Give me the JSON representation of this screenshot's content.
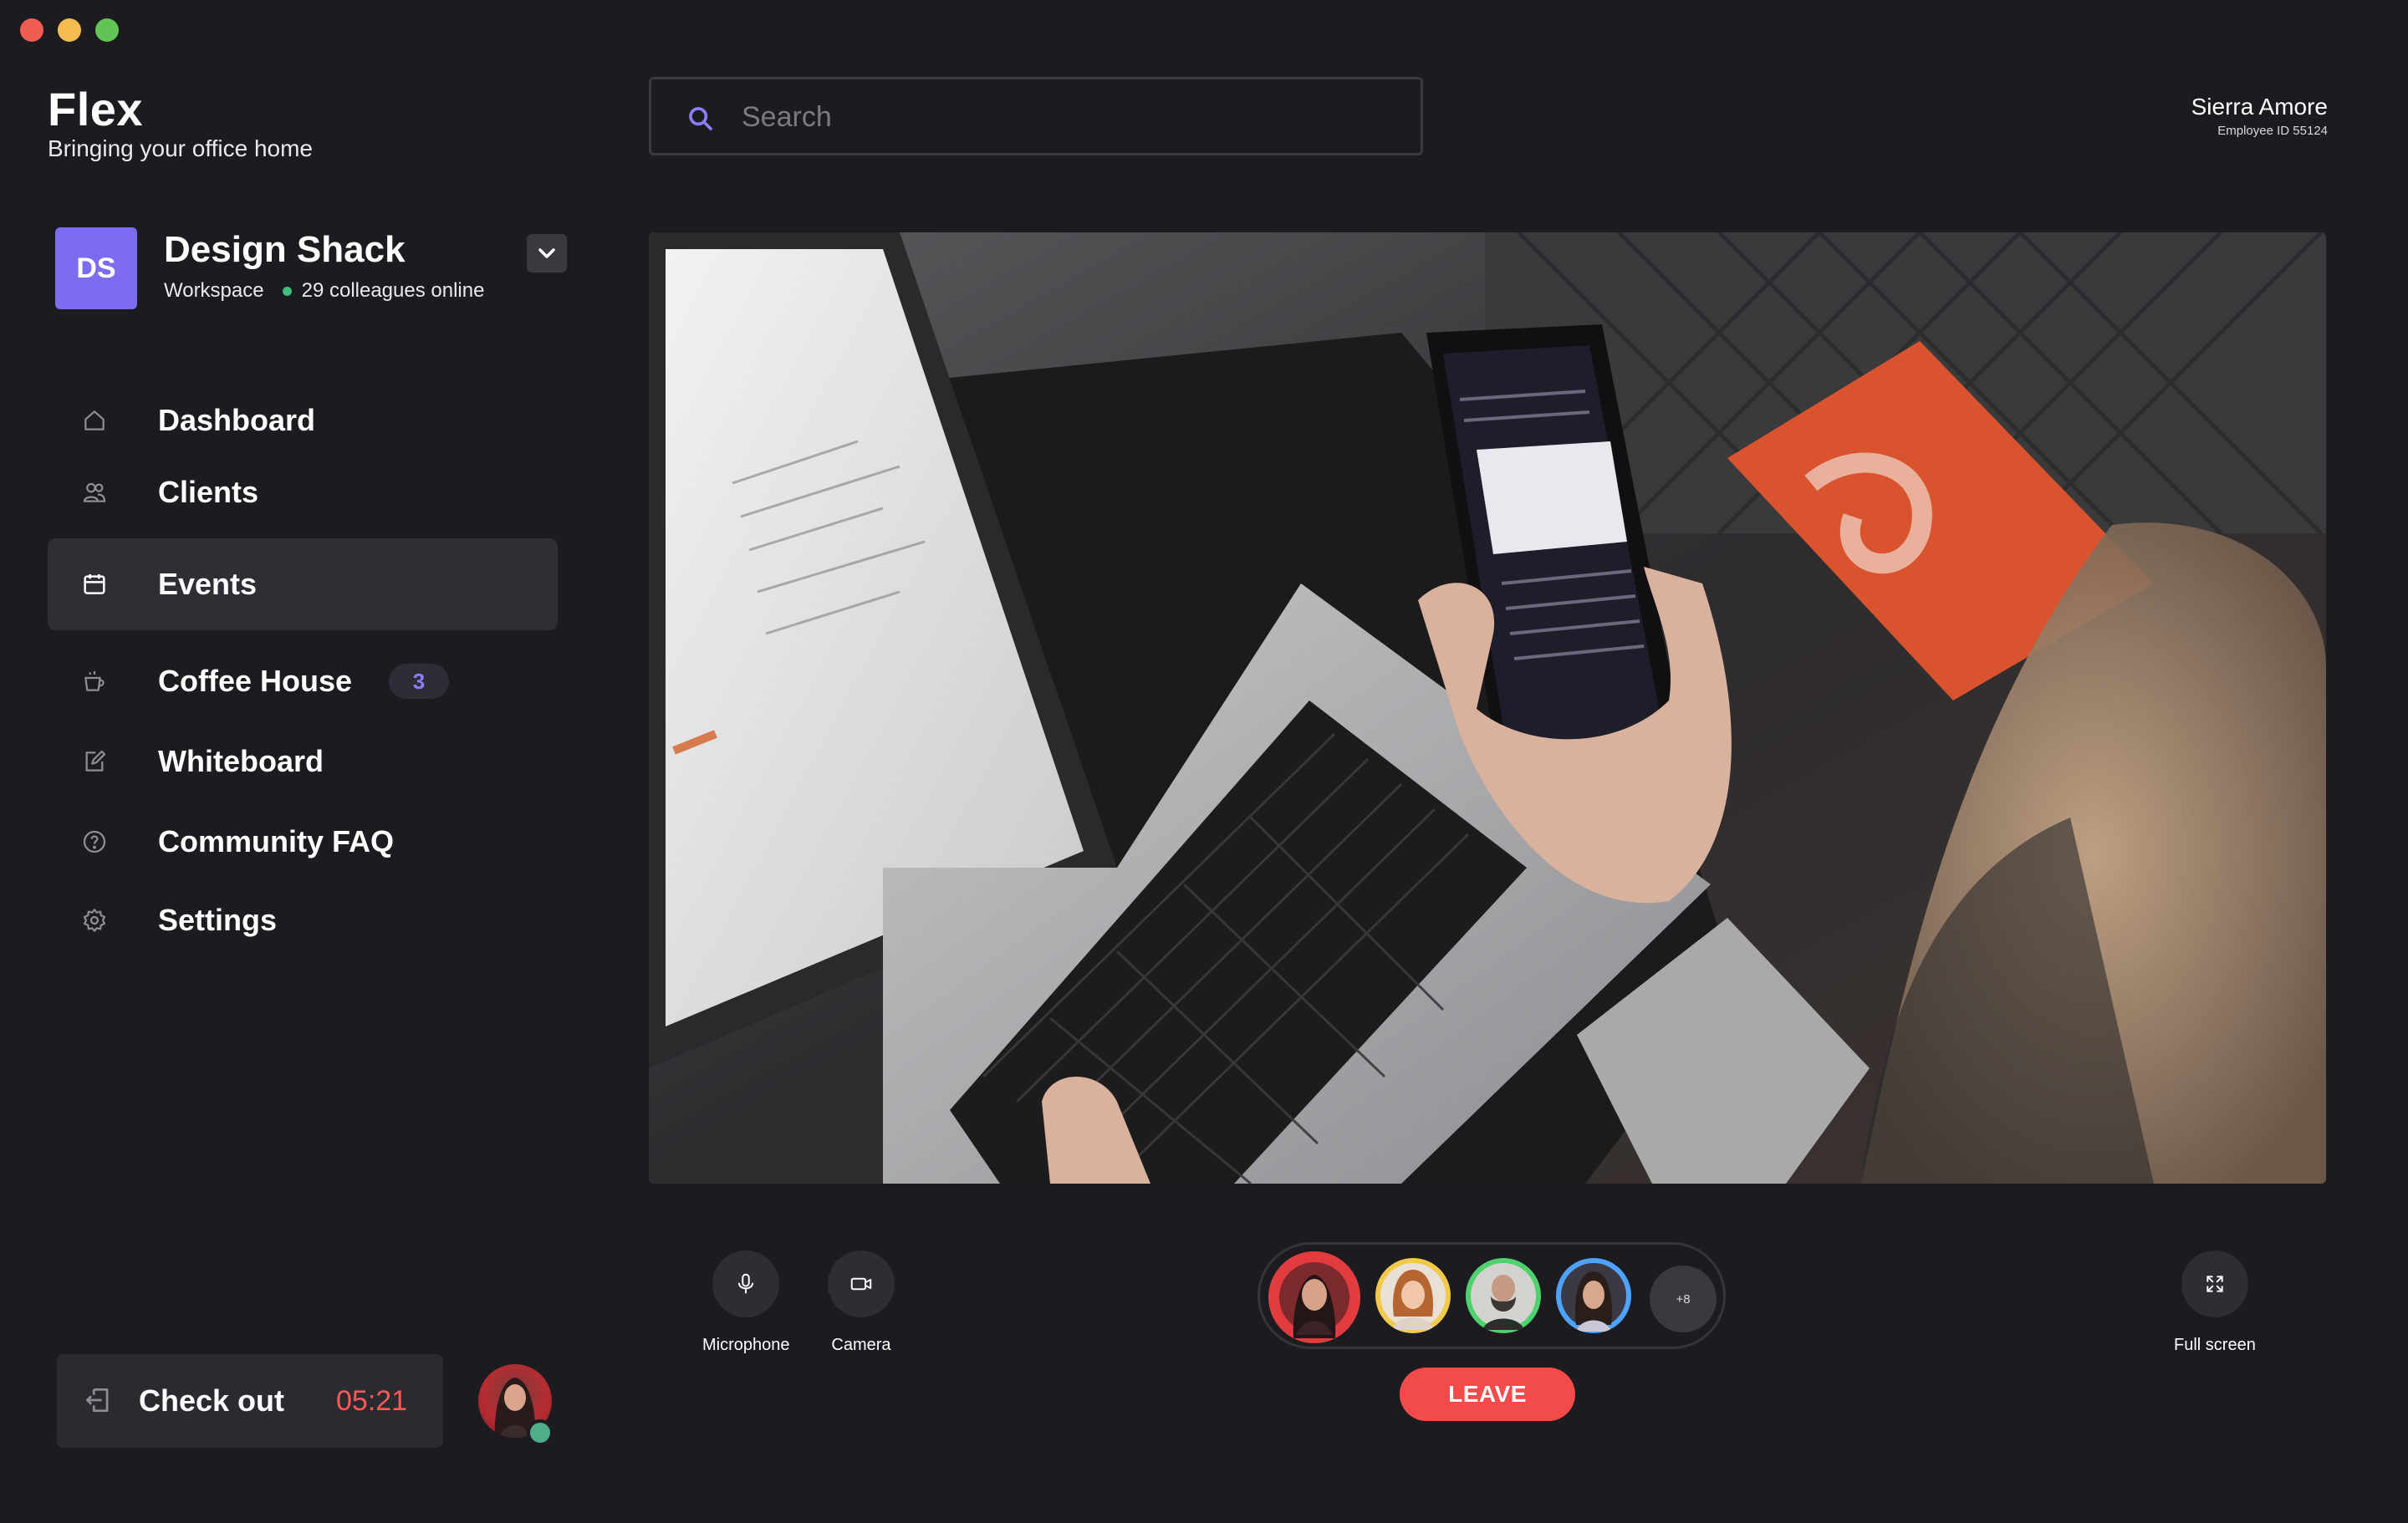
{
  "brand": {
    "title": "Flex",
    "subtitle": "Bringing your office home"
  },
  "workspace": {
    "initials": "DS",
    "name": "Design Shack",
    "type": "Workspace",
    "online": "29 colleagues online"
  },
  "nav": [
    {
      "label": "Dashboard",
      "icon": "home-icon"
    },
    {
      "label": "Clients",
      "icon": "users-icon"
    },
    {
      "label": "Events",
      "icon": "calendar-icon",
      "active": true
    },
    {
      "label": "Coffee House",
      "icon": "coffee-icon",
      "badge": "3"
    },
    {
      "label": "Whiteboard",
      "icon": "edit-icon"
    },
    {
      "label": "Community FAQ",
      "icon": "help-circle-icon"
    },
    {
      "label": "Settings",
      "icon": "gear-icon"
    }
  ],
  "checkout": {
    "label": "Check out",
    "timer": "05:21"
  },
  "search": {
    "placeholder": "Search"
  },
  "user": {
    "name": "Sierra Amore",
    "employee_id": "Employee ID 55124"
  },
  "controls": {
    "microphone": "Microphone",
    "camera": "Camera",
    "fullscreen": "Full screen",
    "more_count": "+8",
    "leave": "LEAVE"
  },
  "colors": {
    "background": "#1c1b1f",
    "accent": "#7c6cf0",
    "danger": "#f34a4a",
    "online": "#3fbf7f"
  }
}
